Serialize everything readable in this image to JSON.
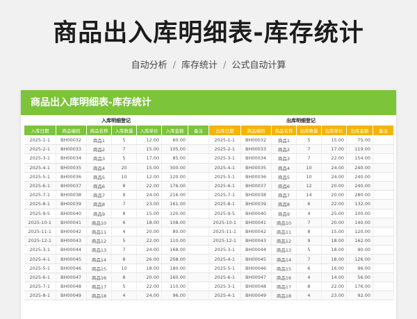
{
  "title": "商品出入库明细表-库存统计",
  "subtitle": {
    "items": [
      "自动分析",
      "库存统计",
      "公式自动计算"
    ],
    "separator": "/"
  },
  "card_title": "商品出入库明细表-库存统计",
  "inbound": {
    "section_title": "入库明细登记",
    "headers": [
      "入库日期",
      "商品编码",
      "商品名称",
      "入库数量",
      "入库单价",
      "入库金额",
      "备注"
    ],
    "rows": [
      [
        "2025-1-1",
        "BH00032",
        "商品1",
        "5",
        "12.00",
        "60.00",
        ""
      ],
      [
        "2025-2-1",
        "BH00033",
        "商品2",
        "7",
        "15.00",
        "105.00",
        ""
      ],
      [
        "2025-3-1",
        "BH00034",
        "商品3",
        "5",
        "17.00",
        "85.00",
        ""
      ],
      [
        "2025-4-1",
        "BH00035",
        "商品4",
        "20",
        "15.00",
        "300.00",
        ""
      ],
      [
        "2025-5-1",
        "BH00036",
        "商品5",
        "10",
        "12.00",
        "120.00",
        ""
      ],
      [
        "2025-6-1",
        "BH00037",
        "商品6",
        "8",
        "22.00",
        "176.00",
        ""
      ],
      [
        "2025-7-1",
        "BH00038",
        "商品7",
        "9",
        "24.00",
        "216.00",
        ""
      ],
      [
        "2025-8-1",
        "BH00039",
        "商品8",
        "7",
        "23.00",
        "161.00",
        ""
      ],
      [
        "2025-9-5",
        "BH00040",
        "商品9",
        "8",
        "15.00",
        "120.00",
        ""
      ],
      [
        "2025-10-1",
        "BH00041",
        "商品10",
        "6",
        "18.00",
        "108.00",
        ""
      ],
      [
        "2025-11-1",
        "BH00042",
        "商品11",
        "4",
        "20.00",
        "80.00",
        ""
      ],
      [
        "2025-12-1",
        "BH00043",
        "商品12",
        "5",
        "22.00",
        "110.00",
        ""
      ],
      [
        "2025-3-1",
        "BH00044",
        "商品13",
        "7",
        "24.00",
        "168.00",
        ""
      ],
      [
        "2025-4-1",
        "BH00045",
        "商品14",
        "8",
        "26.00",
        "208.00",
        ""
      ],
      [
        "2025-5-1",
        "BH00046",
        "商品15",
        "10",
        "18.00",
        "180.00",
        ""
      ],
      [
        "2025-6-1",
        "BH00047",
        "商品16",
        "8",
        "20.00",
        "160.00",
        ""
      ],
      [
        "2025-7-1",
        "BH00048",
        "商品17",
        "5",
        "22.00",
        "110.00",
        ""
      ],
      [
        "2025-8-1",
        "BH00049",
        "商品18",
        "4",
        "24.00",
        "96.00",
        ""
      ]
    ]
  },
  "outbound": {
    "section_title": "出库明细登记",
    "headers": [
      "出库日期",
      "商品编码",
      "商品名称",
      "出库数量",
      "出库单价",
      "出库金额",
      "备注"
    ],
    "rows": [
      [
        "2025-1-1",
        "BH00032",
        "商品1",
        "5",
        "15.00",
        "75.00",
        ""
      ],
      [
        "2025-2-1",
        "BH00033",
        "商品2",
        "7",
        "17.00",
        "119.00",
        ""
      ],
      [
        "2025-3-1",
        "BH00034",
        "商品3",
        "7",
        "22.00",
        "154.00",
        ""
      ],
      [
        "2025-4-1",
        "BH00035",
        "商品4",
        "10",
        "24.00",
        "240.00",
        ""
      ],
      [
        "2025-5-1",
        "BH00036",
        "商品5",
        "10",
        "24.00",
        "240.00",
        ""
      ],
      [
        "2025-6-1",
        "BH00037",
        "商品6",
        "12",
        "20.00",
        "240.00",
        ""
      ],
      [
        "2025-7-1",
        "BH00038",
        "商品7",
        "14",
        "20.00",
        "280.00",
        ""
      ],
      [
        "2025-8-1",
        "BH00039",
        "商品8",
        "6",
        "22.00",
        "132.00",
        ""
      ],
      [
        "2025-9-5",
        "BH00040",
        "商品9",
        "4",
        "25.00",
        "100.00",
        ""
      ],
      [
        "2025-10-1",
        "BH00041",
        "商品10",
        "7",
        "20.00",
        "140.00",
        ""
      ],
      [
        "2025-11-1",
        "BH00042",
        "商品11",
        "8",
        "15.00",
        "120.00",
        ""
      ],
      [
        "2025-12-1",
        "BH00043",
        "商品12",
        "9",
        "18.00",
        "162.00",
        ""
      ],
      [
        "2025-3-1",
        "BH00044",
        "商品13",
        "5",
        "18.00",
        "90.00",
        ""
      ],
      [
        "2025-4-1",
        "BH00045",
        "商品14",
        "7",
        "18.00",
        "126.00",
        ""
      ],
      [
        "2025-5-1",
        "BH00046",
        "商品15",
        "6",
        "16.00",
        "96.00",
        ""
      ],
      [
        "2025-6-1",
        "BH00047",
        "商品16",
        "4",
        "14.00",
        "56.00",
        ""
      ],
      [
        "2025-3-1",
        "BH00048",
        "商品17",
        "8",
        "22.00",
        "176.00",
        ""
      ],
      [
        "2025-4-1",
        "BH00049",
        "商品18",
        "4",
        "23.00",
        "92.00",
        ""
      ]
    ]
  },
  "colors": {
    "inbound_header": "#7cc43a",
    "outbound_header": "#f5b400",
    "card_header": "#7cc43a"
  }
}
